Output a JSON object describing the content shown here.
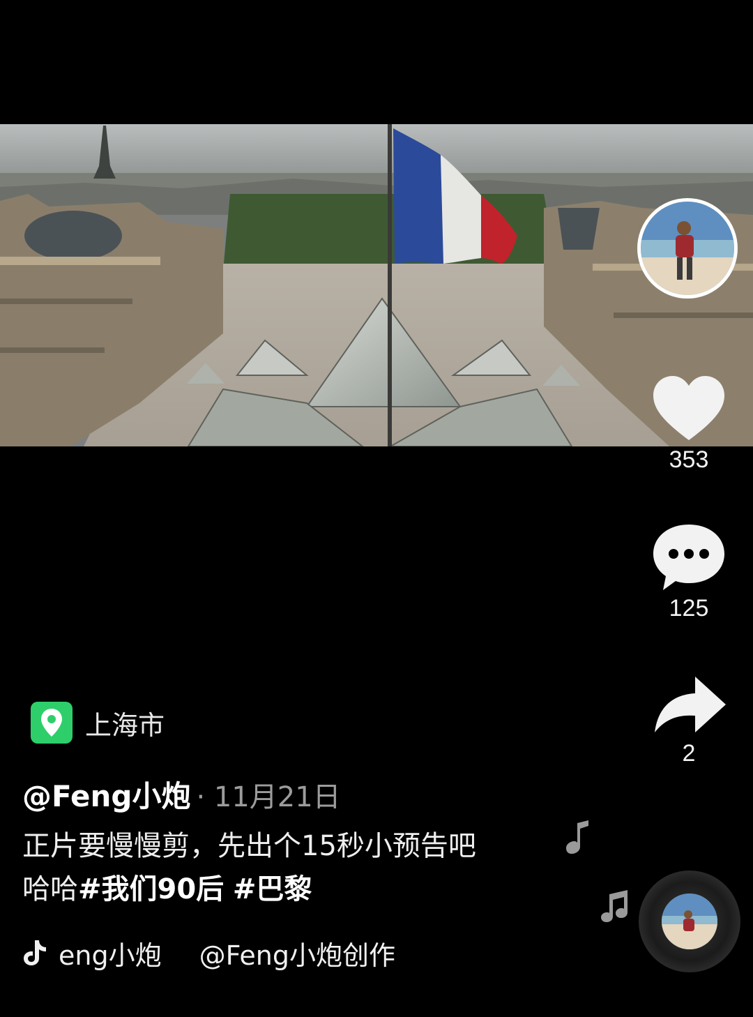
{
  "location": {
    "icon": "location-pin-icon",
    "label": "上海市",
    "badge_color": "#2ecf6a"
  },
  "post": {
    "author": "@Feng小炮",
    "date": "· 11月21日",
    "caption_line1": "正片要慢慢剪，先出个15秒小预告吧",
    "caption_prefix": "哈哈",
    "tags": [
      "#我们90后",
      "#巴黎"
    ]
  },
  "music": {
    "icon": "tiktok-note-icon",
    "track": "eng小炮",
    "credit": "@Feng小炮创作"
  },
  "actions": {
    "like": {
      "icon": "heart-icon",
      "count": "353"
    },
    "comment": {
      "icon": "comment-bubble-icon",
      "count": "125"
    },
    "share": {
      "icon": "share-arrow-icon",
      "count": "2"
    }
  }
}
